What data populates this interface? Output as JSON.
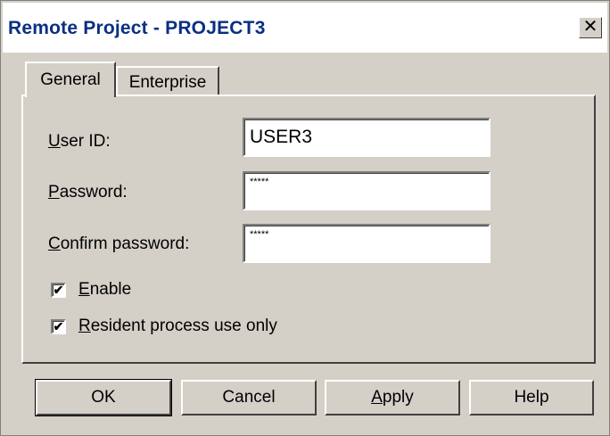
{
  "window": {
    "title": "Remote Project - PROJECT3",
    "close_symbol": "✕"
  },
  "tabs": [
    {
      "label": "General",
      "selected": true
    },
    {
      "label": "Enterprise",
      "selected": false
    }
  ],
  "form": {
    "user_id": {
      "label": "User ID:",
      "mnemonic": "U",
      "label_rest": "ser ID:",
      "value": "USER3"
    },
    "password": {
      "label": "Password:",
      "mnemonic": "P",
      "label_rest": "assword:",
      "value": "*****"
    },
    "confirm_password": {
      "label": "Confirm password:",
      "mnemonic": "C",
      "label_rest": "onfirm password:",
      "value": "*****"
    },
    "enable": {
      "label": "Enable",
      "mnemonic": "E",
      "label_rest": "nable",
      "checked": true
    },
    "resident": {
      "label": "Resident process use only",
      "mnemonic": "R",
      "label_rest": "esident process use only",
      "checked": true
    }
  },
  "buttons": {
    "ok": "OK",
    "cancel": "Cancel",
    "apply": {
      "label": "Apply",
      "mnemonic": "A",
      "label_rest": "pply"
    },
    "help": "Help"
  },
  "check_mark": "✔"
}
